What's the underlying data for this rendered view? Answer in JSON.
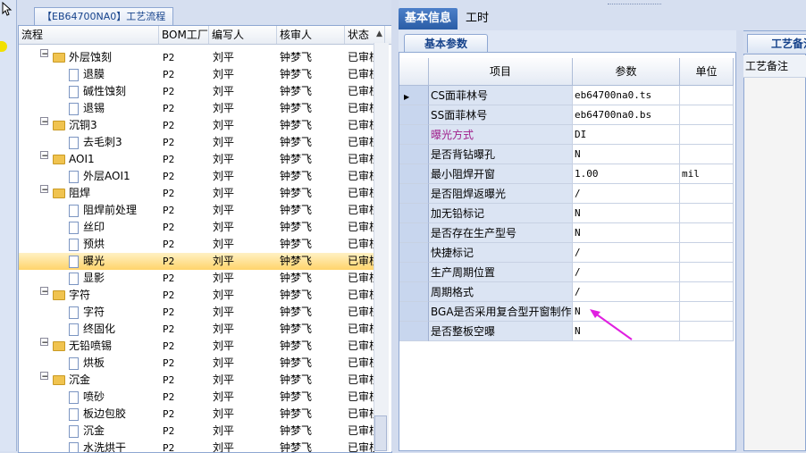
{
  "left_panel": {
    "title": "【EB64700NA0】工艺流程",
    "columns": [
      "流程",
      "BOM工厂",
      "编写人",
      "核审人",
      "状态"
    ],
    "rows": [
      {
        "indent": 1,
        "kind": "folder",
        "name": "外层蚀刻",
        "bom": "P2",
        "writer": "刘平",
        "reviewer": "钟梦飞",
        "status": "已审核"
      },
      {
        "indent": 2,
        "kind": "doc",
        "name": "退膜",
        "bom": "P2",
        "writer": "刘平",
        "reviewer": "钟梦飞",
        "status": "已审核"
      },
      {
        "indent": 2,
        "kind": "doc",
        "name": "碱性蚀刻",
        "bom": "P2",
        "writer": "刘平",
        "reviewer": "钟梦飞",
        "status": "已审核"
      },
      {
        "indent": 2,
        "kind": "doc",
        "name": "退锡",
        "bom": "P2",
        "writer": "刘平",
        "reviewer": "钟梦飞",
        "status": "已审核"
      },
      {
        "indent": 1,
        "kind": "folder",
        "name": "沉铜3",
        "bom": "P2",
        "writer": "刘平",
        "reviewer": "钟梦飞",
        "status": "已审核"
      },
      {
        "indent": 2,
        "kind": "doc",
        "name": "去毛刺3",
        "bom": "P2",
        "writer": "刘平",
        "reviewer": "钟梦飞",
        "status": "已审核"
      },
      {
        "indent": 1,
        "kind": "folder",
        "name": "AOI1",
        "bom": "P2",
        "writer": "刘平",
        "reviewer": "钟梦飞",
        "status": "已审核"
      },
      {
        "indent": 2,
        "kind": "doc",
        "name": "外层AOI1",
        "bom": "P2",
        "writer": "刘平",
        "reviewer": "钟梦飞",
        "status": "已审核"
      },
      {
        "indent": 1,
        "kind": "folder",
        "name": "阻焊",
        "bom": "P2",
        "writer": "刘平",
        "reviewer": "钟梦飞",
        "status": "已审核"
      },
      {
        "indent": 2,
        "kind": "doc",
        "name": "阻焊前处理",
        "bom": "P2",
        "writer": "刘平",
        "reviewer": "钟梦飞",
        "status": "已审核"
      },
      {
        "indent": 2,
        "kind": "doc",
        "name": "丝印",
        "bom": "P2",
        "writer": "刘平",
        "reviewer": "钟梦飞",
        "status": "已审核"
      },
      {
        "indent": 2,
        "kind": "doc",
        "name": "预烘",
        "bom": "P2",
        "writer": "刘平",
        "reviewer": "钟梦飞",
        "status": "已审核"
      },
      {
        "indent": 2,
        "kind": "doc",
        "name": "曝光",
        "bom": "P2",
        "writer": "刘平",
        "reviewer": "钟梦飞",
        "status": "已审核",
        "selected": true
      },
      {
        "indent": 2,
        "kind": "doc",
        "name": "显影",
        "bom": "P2",
        "writer": "刘平",
        "reviewer": "钟梦飞",
        "status": "已审核"
      },
      {
        "indent": 1,
        "kind": "folder",
        "name": "字符",
        "bom": "P2",
        "writer": "刘平",
        "reviewer": "钟梦飞",
        "status": "已审核"
      },
      {
        "indent": 2,
        "kind": "doc",
        "name": "字符",
        "bom": "P2",
        "writer": "刘平",
        "reviewer": "钟梦飞",
        "status": "已审核"
      },
      {
        "indent": 2,
        "kind": "doc",
        "name": "终固化",
        "bom": "P2",
        "writer": "刘平",
        "reviewer": "钟梦飞",
        "status": "已审核"
      },
      {
        "indent": 1,
        "kind": "folder",
        "name": "无铅喷锡",
        "bom": "P2",
        "writer": "刘平",
        "reviewer": "钟梦飞",
        "status": "已审核"
      },
      {
        "indent": 2,
        "kind": "doc",
        "name": "烘板",
        "bom": "P2",
        "writer": "刘平",
        "reviewer": "钟梦飞",
        "status": "已审核"
      },
      {
        "indent": 1,
        "kind": "folder",
        "name": "沉金",
        "bom": "P2",
        "writer": "刘平",
        "reviewer": "钟梦飞",
        "status": "已审核"
      },
      {
        "indent": 2,
        "kind": "doc",
        "name": "喷砂",
        "bom": "P2",
        "writer": "刘平",
        "reviewer": "钟梦飞",
        "status": "已审核"
      },
      {
        "indent": 2,
        "kind": "doc",
        "name": "板边包胶",
        "bom": "P2",
        "writer": "刘平",
        "reviewer": "钟梦飞",
        "status": "已审核"
      },
      {
        "indent": 2,
        "kind": "doc",
        "name": "沉金",
        "bom": "P2",
        "writer": "刘平",
        "reviewer": "钟梦飞",
        "status": "已审核"
      },
      {
        "indent": 2,
        "kind": "doc",
        "name": "水洗烘干",
        "bom": "P2",
        "writer": "刘平",
        "reviewer": "钟梦飞",
        "status": "已审核"
      }
    ]
  },
  "tabs": {
    "basic_info": "基本信息",
    "work_hours": "工时"
  },
  "subtab": {
    "basic_params": "基本参数"
  },
  "grid": {
    "columns": {
      "item": "项目",
      "param": "参数",
      "unit": "单位"
    },
    "rows": [
      {
        "item": "CS面菲林号",
        "param": "eb64700na0.ts",
        "unit": "",
        "current": true
      },
      {
        "item": "SS面菲林号",
        "param": "eb64700na0.bs",
        "unit": ""
      },
      {
        "item": "曝光方式",
        "param": "DI",
        "unit": "",
        "highlight": true
      },
      {
        "item": "是否背钻曝孔",
        "param": "N",
        "unit": ""
      },
      {
        "item": "最小阻焊开窗",
        "param": "1.00",
        "unit": "mil"
      },
      {
        "item": "是否阻焊返曝光",
        "param": "/",
        "unit": ""
      },
      {
        "item": "加无铅标记",
        "param": "N",
        "unit": ""
      },
      {
        "item": "是否存在生产型号",
        "param": "N",
        "unit": ""
      },
      {
        "item": "快捷标记",
        "param": "/",
        "unit": ""
      },
      {
        "item": "生产周期位置",
        "param": "/",
        "unit": ""
      },
      {
        "item": "周期格式",
        "param": "/",
        "unit": ""
      },
      {
        "item": "BGA是否采用复合型开窗制作",
        "param": "N",
        "unit": ""
      },
      {
        "item": "是否整板空曝",
        "param": "N",
        "unit": ""
      }
    ]
  },
  "far_panel": {
    "tab": "工艺备注",
    "label": "工艺备注"
  },
  "colors": {
    "accent": "#2a5da6",
    "highlight_text": "#a0208c",
    "arrow": "#e020e0",
    "selected_row": "#ffd46b"
  }
}
